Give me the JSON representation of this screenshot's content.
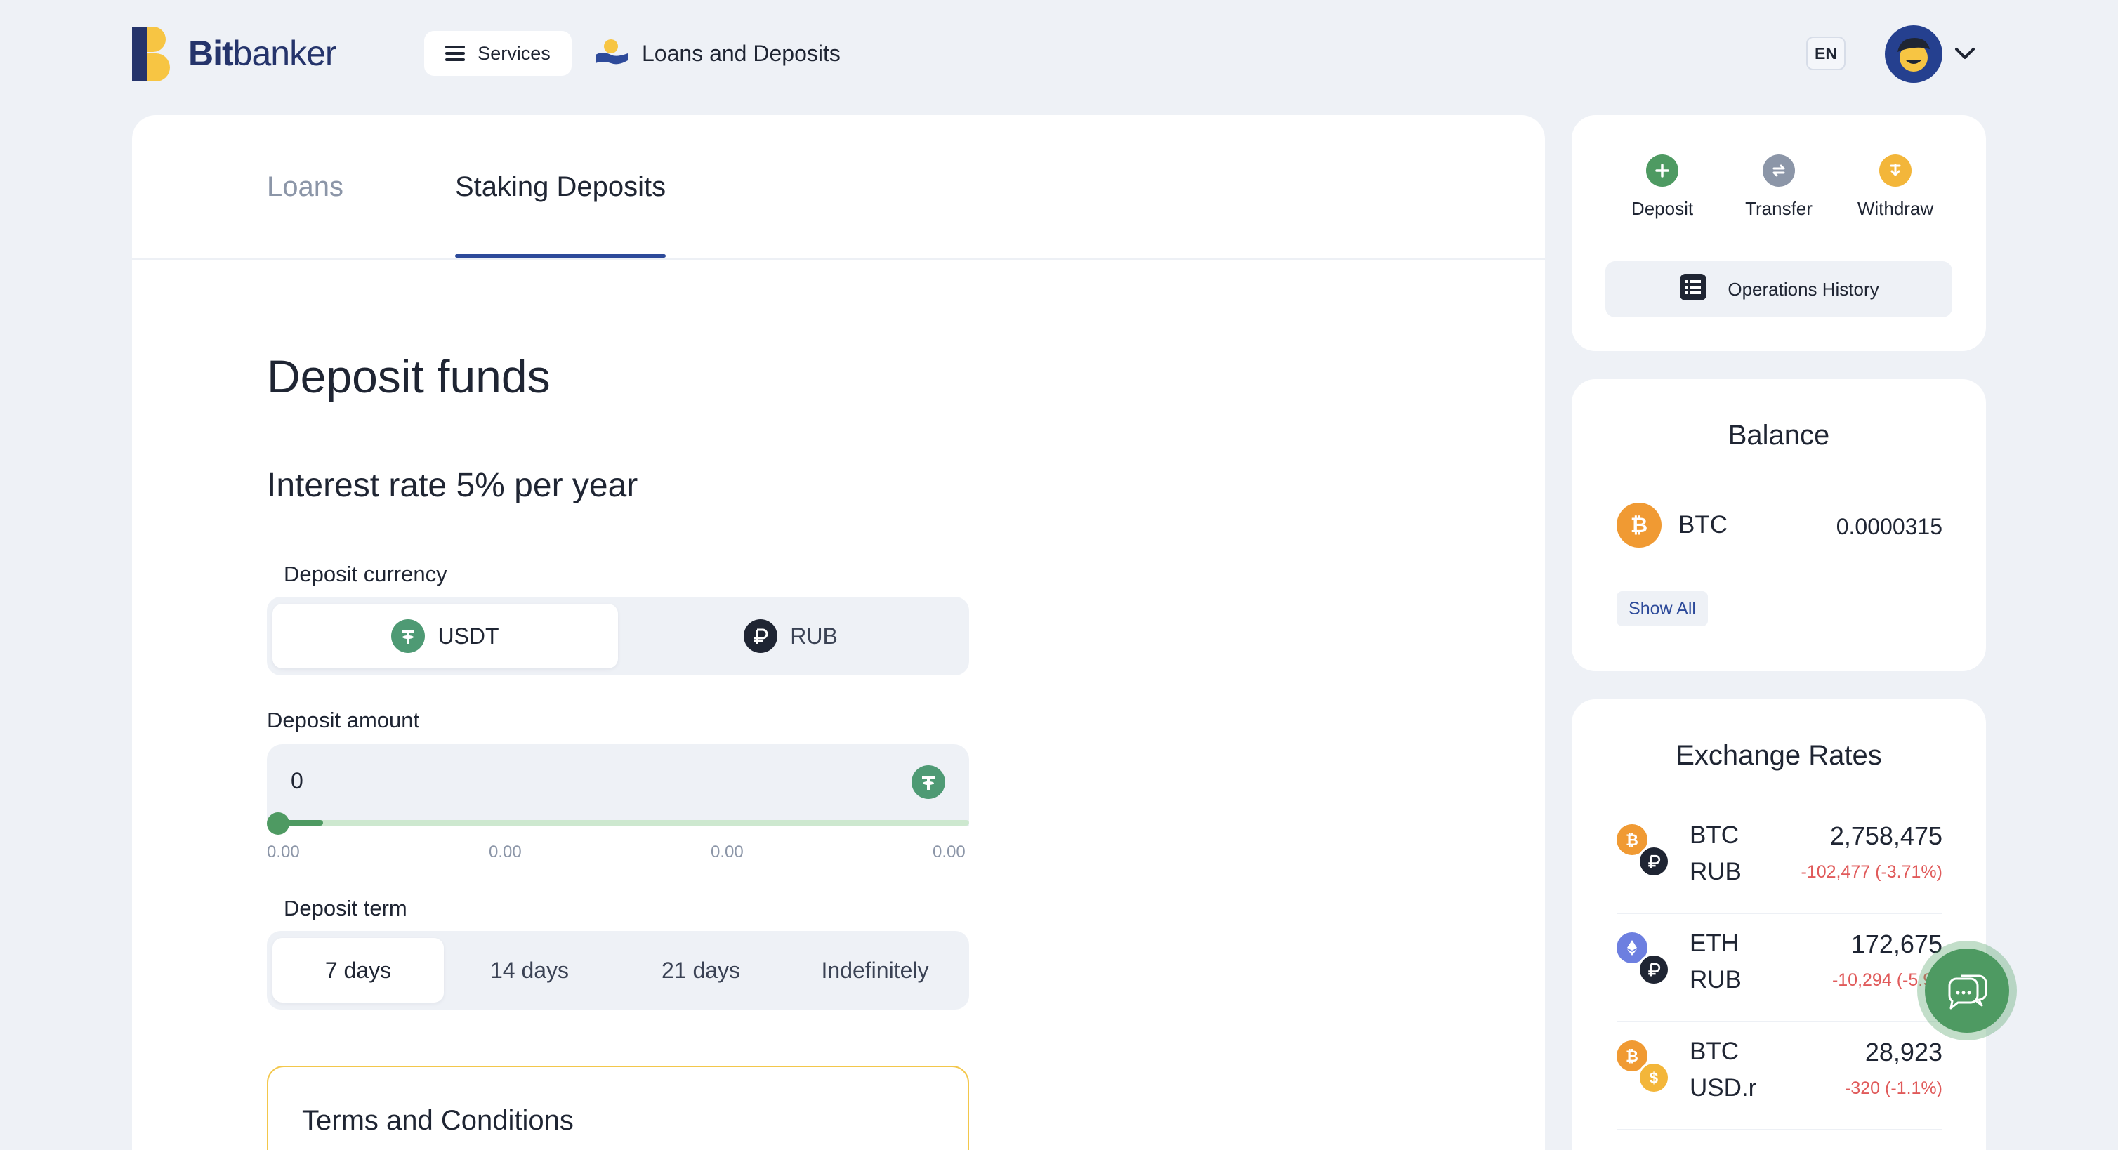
{
  "header": {
    "logo_bold": "Bit",
    "logo_light": "banker",
    "services_label": "Services",
    "breadcrumb": "Loans and Deposits",
    "lang": "EN"
  },
  "tabs": [
    {
      "label": "Loans",
      "active": false
    },
    {
      "label": "Staking Deposits",
      "active": true
    }
  ],
  "form": {
    "title": "Deposit funds",
    "rate_text": "Interest rate 5% per year",
    "currency_label": "Deposit currency",
    "currencies": [
      {
        "label": "USDT",
        "selected": true
      },
      {
        "label": "RUB",
        "selected": false
      }
    ],
    "amount_label": "Deposit amount",
    "amount_value": "0",
    "slider_level": 0.0,
    "ticks": [
      "0.00",
      "0.00",
      "0.00",
      "0.00"
    ],
    "term_label": "Deposit term",
    "terms": [
      {
        "label": "7 days",
        "selected": true
      },
      {
        "label": "14 days",
        "selected": false
      },
      {
        "label": "21 days",
        "selected": false
      },
      {
        "label": "Indefinitely",
        "selected": false
      }
    ],
    "terms_title": "Terms and Conditions"
  },
  "actions": {
    "deposit": "Deposit",
    "transfer": "Transfer",
    "withdraw": "Withdraw",
    "operations_history": "Operations History"
  },
  "balance": {
    "title": "Balance",
    "items": [
      {
        "symbol": "BTC",
        "value": "0.0000315"
      }
    ],
    "show_all": "Show All"
  },
  "rates": {
    "title": "Exchange Rates",
    "items": [
      {
        "base": "BTC",
        "quote": "RUB",
        "price": "2,758,475",
        "change": "-102,477 (-3.71%)"
      },
      {
        "base": "ETH",
        "quote": "RUB",
        "price": "172,675",
        "change": "-10,294 (-5.96"
      },
      {
        "base": "BTC",
        "quote": "USD.r",
        "price": "28,923",
        "change": "-320 (-1.1%)"
      }
    ]
  },
  "colors": {
    "accent": "#2d4a9a",
    "green": "#4e9a62",
    "tether": "#4e9a74",
    "btc": "#f09a33",
    "negative": "#e05a5a",
    "logo_yellow": "#f7c543",
    "logo_blue": "#25346b"
  }
}
